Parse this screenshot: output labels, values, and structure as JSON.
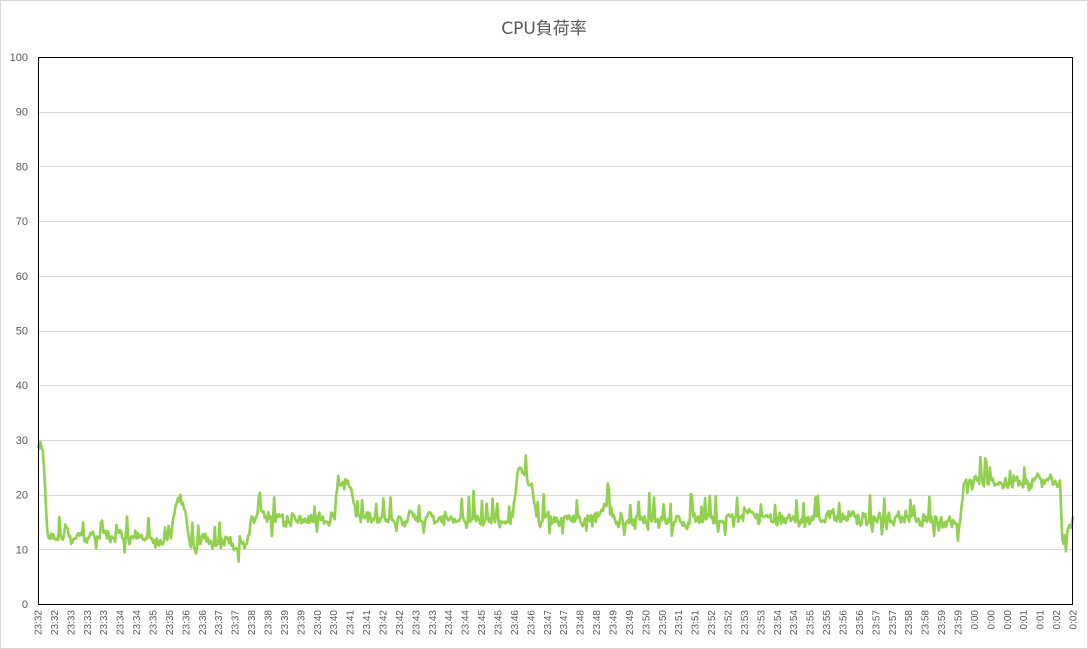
{
  "chart_data": {
    "type": "line",
    "title": "CPU負荷率",
    "xlabel": "",
    "ylabel": "",
    "ylim": [
      0,
      100
    ],
    "yticks": [
      0,
      10,
      20,
      30,
      40,
      50,
      60,
      70,
      80,
      90,
      100
    ],
    "grid": true,
    "legend": "none",
    "xticklabels": [
      "23:32",
      "23:32",
      "23:33",
      "23:33",
      "23:33",
      "23:34",
      "23:34",
      "23:35",
      "23:35",
      "23:36",
      "23:36",
      "23:37",
      "23:37",
      "23:38",
      "23:38",
      "23:39",
      "23:39",
      "23:40",
      "23:40",
      "23:41",
      "23:41",
      "23:42",
      "23:42",
      "23:43",
      "23:43",
      "23:44",
      "23:44",
      "23:45",
      "23:45",
      "23:46",
      "23:46",
      "23:47",
      "23:47",
      "23:48",
      "23:48",
      "23:49",
      "23:49",
      "23:50",
      "23:50",
      "23:51",
      "23:51",
      "23:52",
      "23:52",
      "23:53",
      "23:53",
      "23:54",
      "23:54",
      "23:55",
      "23:55",
      "23:56",
      "23:56",
      "23:57",
      "23:57",
      "23:58",
      "23:58",
      "23:59",
      "23:59",
      "0:00",
      "0:00",
      "0:00",
      "0:01",
      "0:01",
      "0:02",
      "0:02"
    ],
    "series": [
      {
        "name": "",
        "color": "#92d050",
        "values": [
          29,
          28,
          13,
          12,
          12,
          12,
          14,
          11,
          12,
          13,
          12,
          13,
          12,
          12,
          13,
          12,
          12,
          13,
          12,
          12,
          12,
          13,
          12,
          12,
          12,
          12,
          11,
          12,
          12,
          18,
          20,
          17,
          11,
          10,
          11,
          12,
          11,
          11,
          11,
          11,
          12,
          11,
          10,
          11,
          11,
          16,
          16,
          17,
          16,
          16,
          15,
          16,
          15,
          15,
          16,
          16,
          15,
          16,
          15,
          16,
          16,
          15,
          16,
          21,
          22,
          22,
          21,
          16,
          15,
          16,
          16,
          16,
          15,
          16,
          16,
          15,
          16,
          15,
          16,
          16,
          15,
          15,
          16,
          16,
          15,
          15,
          16,
          16,
          15,
          16,
          15,
          15,
          16,
          15,
          15,
          15,
          16,
          15,
          15,
          15,
          16,
          24,
          24,
          23,
          22,
          16,
          15,
          16,
          16,
          15,
          15,
          16,
          16,
          15,
          16,
          15,
          16,
          16,
          16,
          17,
          22,
          16,
          15,
          16,
          15,
          15,
          16,
          16,
          15,
          16,
          15,
          15,
          16,
          15,
          15,
          16,
          15,
          15,
          16,
          16,
          15,
          16,
          16,
          15,
          15,
          16,
          16,
          16,
          16,
          17,
          17,
          16,
          15,
          16,
          16,
          15,
          16,
          15,
          16,
          16,
          16,
          15,
          15,
          16,
          16,
          15,
          16,
          17,
          16,
          15,
          16,
          16,
          16,
          15,
          16,
          15,
          16,
          16,
          15,
          16,
          15,
          16,
          16,
          16,
          16,
          15,
          15,
          16,
          15,
          16,
          15,
          15,
          16,
          15,
          14,
          22,
          22,
          22,
          23,
          22,
          22,
          23,
          22,
          22,
          22,
          22,
          23,
          22,
          22,
          22,
          23,
          23,
          22,
          23,
          22,
          22,
          11,
          14,
          16
        ]
      }
    ]
  }
}
